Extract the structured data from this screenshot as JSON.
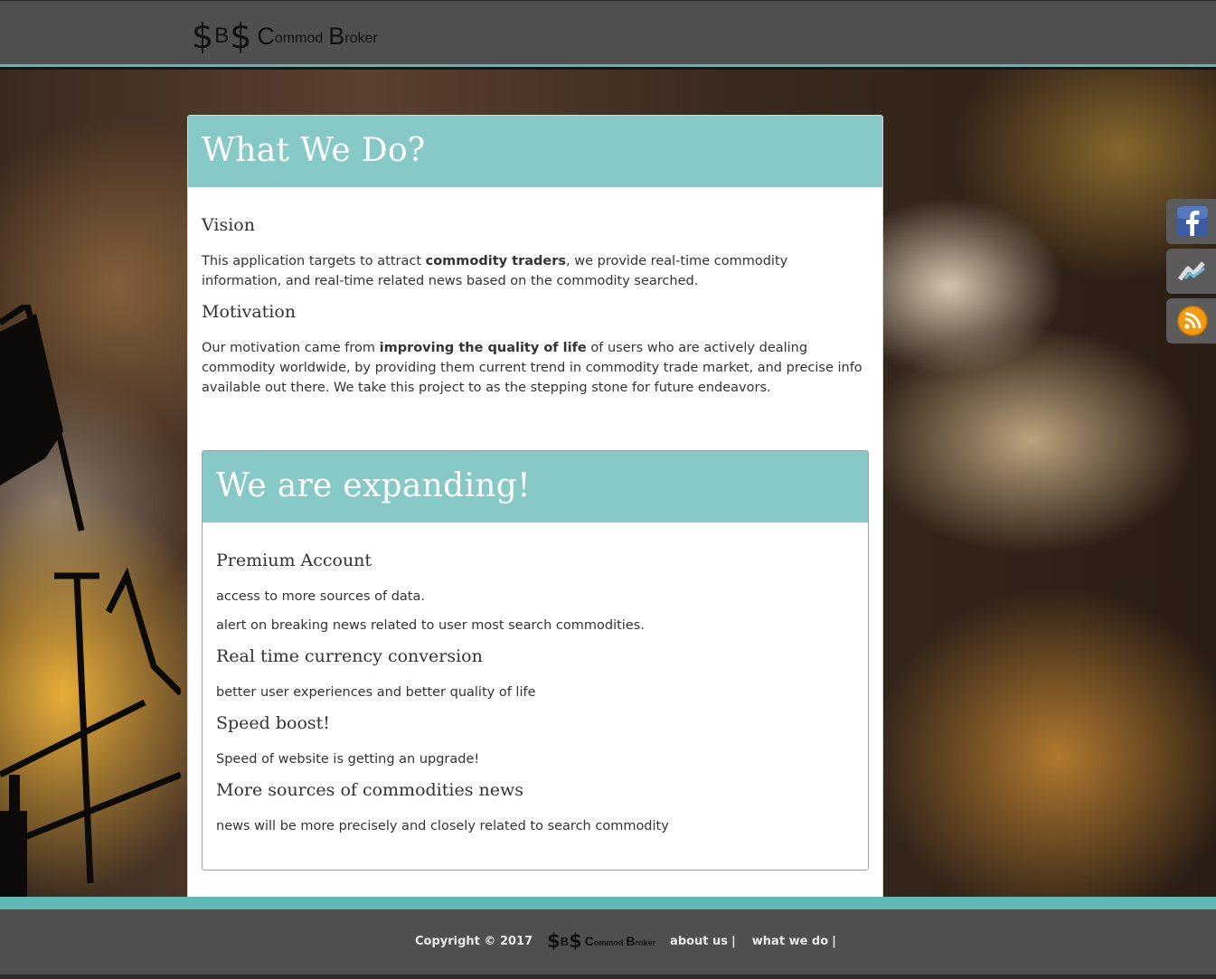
{
  "header": {
    "logo": {
      "mark": "$B$",
      "big_c": "C",
      "small_1": "ommod",
      "big_b": "B",
      "small_2": "roker"
    }
  },
  "main": {
    "title": "What We Do?",
    "vision": {
      "heading": "Vision",
      "text_before": "This application targets to attract ",
      "text_bold": "commodity traders",
      "text_after": ", we provide real-time commodity information, and real-time related news based on the commodity searched."
    },
    "motivation": {
      "heading": "Motivation",
      "text_before": "Our motivation came from ",
      "text_bold": "improving the quality of life",
      "text_after": " of users who are actively dealing commodity worldwide, by providing them current trend in commodity trade market, and precise info available out there. We take this project to as the stepping stone for future endeavors."
    },
    "expanding": {
      "title": "We are expanding!",
      "features": [
        {
          "heading": "Premium Account",
          "lines": [
            "access to more sources of data.",
            "alert on breaking news related to user most search commodities."
          ]
        },
        {
          "heading": "Real time currency conversion",
          "lines": [
            "better user experiences and better quality of life"
          ]
        },
        {
          "heading": "Speed boost!",
          "lines": [
            "Speed of website is getting an upgrade!"
          ]
        },
        {
          "heading": "More sources of commodities news",
          "lines": [
            "news will be more precisely and closely related to search commodity"
          ]
        }
      ]
    }
  },
  "social": [
    {
      "icon": "facebook-icon"
    },
    {
      "icon": "chart-icon"
    },
    {
      "icon": "rss-icon"
    }
  ],
  "footer": {
    "copyright": "Copyright © 2017",
    "links": [
      {
        "label": "about us",
        "sep": "|"
      },
      {
        "label": "what we do",
        "sep": "|"
      }
    ]
  },
  "colors": {
    "accent": "#86c9c6",
    "accent_band": "#5fb8b3",
    "header_bg": "#4f4f4f",
    "panel_bg": "#ffffff"
  }
}
